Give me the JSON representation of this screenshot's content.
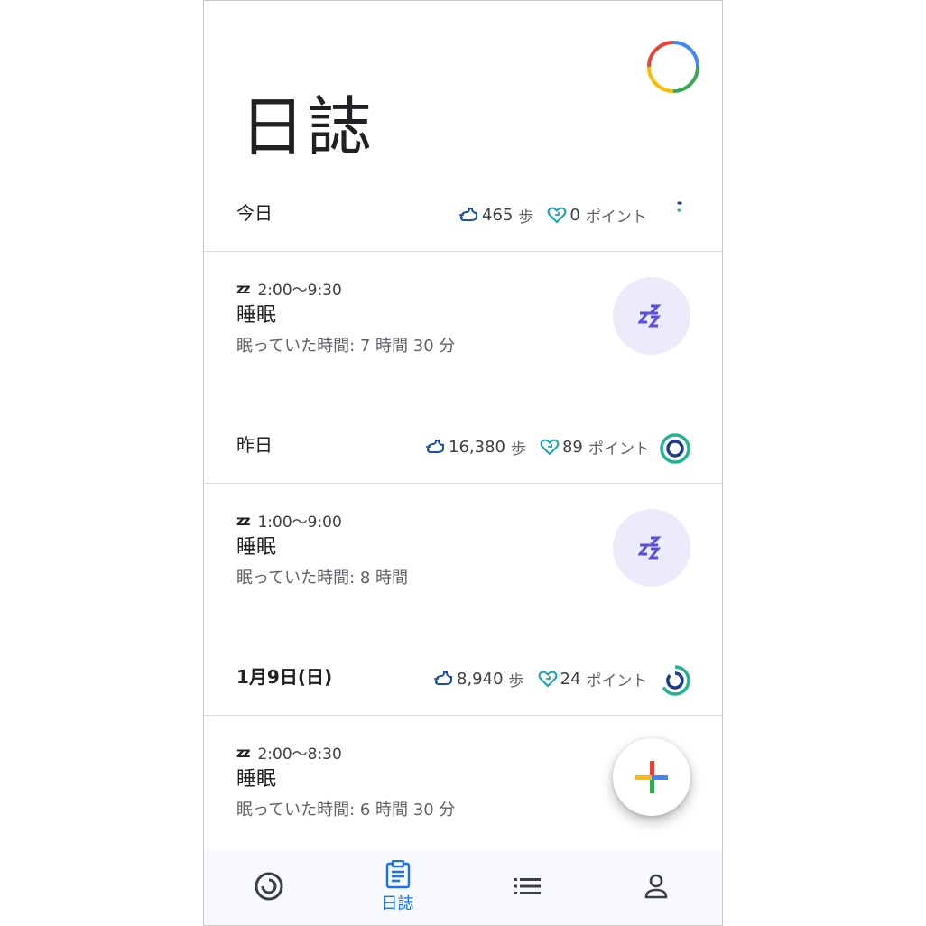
{
  "page": {
    "title": "日誌"
  },
  "colors": {
    "steps_icon": "#174ea6",
    "heart_icon": "#12a4af",
    "sleep_purple": "#5b4fe0",
    "sleep_badge_bg": "#ecebfb",
    "nav_active": "#1a73e8",
    "ring_blue": "#1a3c8f",
    "ring_teal": "#1fb592"
  },
  "days": [
    {
      "label": "今日",
      "steps": "465",
      "steps_unit": "歩",
      "points": "0",
      "points_unit": "ポイント",
      "ring_progress": 0.02
    },
    {
      "label": "昨日",
      "steps": "16,380",
      "steps_unit": "歩",
      "points": "89",
      "points_unit": "ポイント",
      "ring_progress": 1.0
    },
    {
      "label": "1月9日(日)",
      "steps": "8,940",
      "steps_unit": "歩",
      "points": "24",
      "points_unit": "ポイント",
      "ring_progress": 0.85
    }
  ],
  "sleep_entries": [
    {
      "time": "2:00〜9:30",
      "title": "睡眠",
      "duration": "眠っていた時間: 7 時間 30 分"
    },
    {
      "time": "1:00〜9:00",
      "title": "睡眠",
      "duration": "眠っていた時間: 8 時間"
    },
    {
      "time": "2:00〜8:30",
      "title": "睡眠",
      "duration": "眠っていた時間: 6 時間 30 分"
    }
  ],
  "icons": {
    "profile": "profile-ring-icon",
    "steps": "steps-icon",
    "heart_points": "heart-points-icon",
    "sleep": "sleep-zz-icon",
    "add": "add-plus-icon",
    "home": "home-rings-icon",
    "journal": "journal-clipboard-icon",
    "browse": "browse-list-icon",
    "profile_nav": "person-icon"
  },
  "nav": {
    "items": [
      {
        "name": "home",
        "label": ""
      },
      {
        "name": "journal",
        "label": "日誌",
        "active": true
      },
      {
        "name": "browse",
        "label": ""
      },
      {
        "name": "profile",
        "label": ""
      }
    ]
  }
}
